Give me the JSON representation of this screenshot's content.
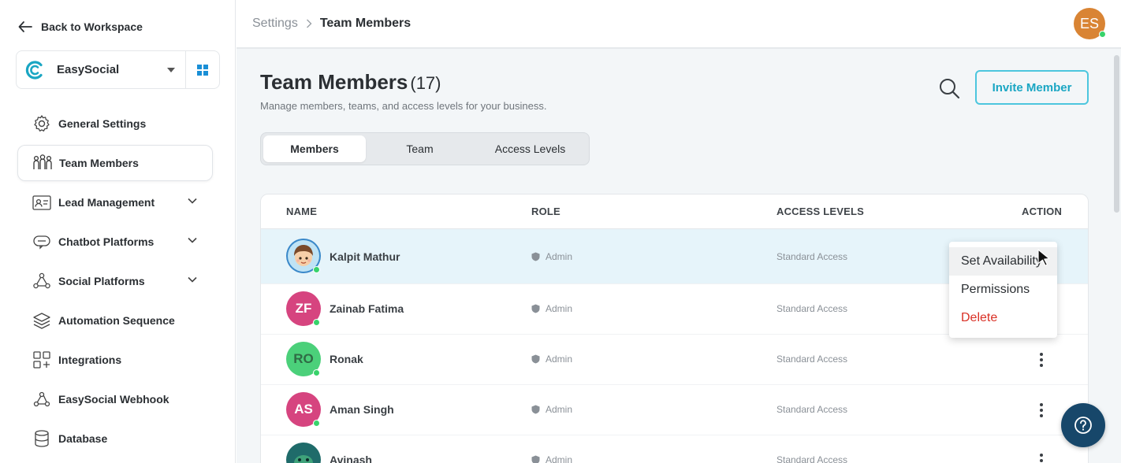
{
  "sidebar": {
    "back_label": "Back to Workspace",
    "workspace": {
      "name": "EasySocial",
      "brand_color": "#1aa6c3"
    },
    "items": [
      {
        "label": "General Settings",
        "icon": "gear-icon",
        "expandable": false,
        "active": false
      },
      {
        "label": "Team Members",
        "icon": "team-icon",
        "expandable": false,
        "active": true
      },
      {
        "label": "Lead Management",
        "icon": "contact-card-icon",
        "expandable": true,
        "active": false
      },
      {
        "label": "Chatbot Platforms",
        "icon": "chatbot-icon",
        "expandable": true,
        "active": false
      },
      {
        "label": "Social Platforms",
        "icon": "social-network-icon",
        "expandable": true,
        "active": false
      },
      {
        "label": "Automation Sequence",
        "icon": "layers-icon",
        "expandable": false,
        "active": false
      },
      {
        "label": "Integrations",
        "icon": "integrations-icon",
        "expandable": false,
        "active": false
      },
      {
        "label": "EasySocial Webhook",
        "icon": "webhook-icon",
        "expandable": false,
        "active": false
      },
      {
        "label": "Database",
        "icon": "database-icon",
        "expandable": false,
        "active": false
      }
    ]
  },
  "header": {
    "breadcrumb": [
      "Settings",
      "Team Members"
    ],
    "user_initials": "ES",
    "user_avatar_color": "#d98434"
  },
  "main": {
    "title": "Team Members",
    "count": "(17)",
    "subtitle": "Manage members, teams, and access levels for your business.",
    "invite_label": "Invite Member",
    "tabs": [
      {
        "label": "Members",
        "active": true
      },
      {
        "label": "Team",
        "active": false
      },
      {
        "label": "Access Levels",
        "active": false
      }
    ],
    "table": {
      "columns": [
        "NAME",
        "ROLE",
        "ACCESS LEVELS",
        "ACTION"
      ],
      "rows": [
        {
          "name": "Kalpit Mathur",
          "initials": "",
          "avatar_type": "illustration",
          "avatar_color": "#3a88c9",
          "role": "Admin",
          "access": "Standard Access",
          "online": true,
          "highlighted": true
        },
        {
          "name": "Zainab Fatima",
          "initials": "ZF",
          "avatar_type": "initials",
          "avatar_color": "#d6447f",
          "role": "Admin",
          "access": "Standard Access",
          "online": true,
          "highlighted": false
        },
        {
          "name": "Ronak",
          "initials": "RO",
          "avatar_type": "initials",
          "avatar_color": "#4bd07a",
          "role": "Admin",
          "access": "Standard Access",
          "online": true,
          "highlighted": false
        },
        {
          "name": "Aman Singh",
          "initials": "AS",
          "avatar_type": "initials",
          "avatar_color": "#d6447f",
          "role": "Admin",
          "access": "Standard Access",
          "online": true,
          "highlighted": false
        },
        {
          "name": "Avinash",
          "initials": "",
          "avatar_type": "illustration",
          "avatar_color": "#1f6b6a",
          "role": "Admin",
          "access": "Standard Access",
          "online": true,
          "highlighted": false
        }
      ]
    },
    "action_menu": {
      "items": [
        {
          "label": "Set Availability",
          "style": "hover"
        },
        {
          "label": "Permissions",
          "style": "normal"
        },
        {
          "label": "Delete",
          "style": "danger"
        }
      ]
    }
  },
  "colors": {
    "accent": "#1aa6c3",
    "online": "#38d36b",
    "danger": "#d93025",
    "help_button": "#17476a",
    "row_highlight": "#e6f4fa"
  }
}
